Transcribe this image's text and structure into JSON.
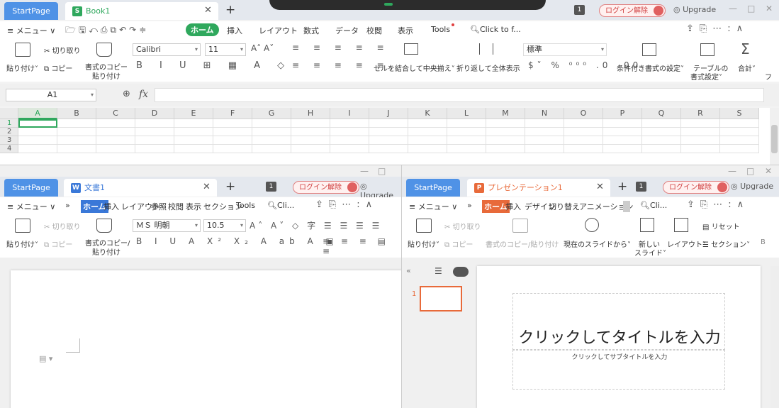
{
  "sheet": {
    "tabs": {
      "start": "StartPage",
      "doc": "Book1"
    },
    "login": "ログイン解除",
    "upgrade": "Upgrade",
    "num_badge": "1",
    "menu": [
      "≡ メニュー ∨",
      "ホーム",
      "挿入",
      "レイアウト",
      "数式",
      "データ",
      "校閲",
      "表示",
      "Tools",
      "Click to f..."
    ],
    "active_menu": "ホーム",
    "ribbon": {
      "paste": "貼り付け˅",
      "cut": "切り取り",
      "copy": "コピー",
      "format_copy": "書式のコピー",
      "format_copy2": "貼り付け",
      "font": "Calibri",
      "size": "11",
      "merge": "セルを結合して中央揃え˅",
      "wrap": "折り返して全体表示",
      "numfmt": "標準",
      "cond": "条件付き書式の設定˅",
      "table": "テーブルの",
      "table2": "書式設定˅",
      "sum": "合計˅",
      "f": "フ"
    },
    "namebox": "A1",
    "fx": "fx",
    "columns": [
      "A",
      "B",
      "C",
      "D",
      "E",
      "F",
      "G",
      "H",
      "I",
      "J",
      "K",
      "L",
      "M",
      "N",
      "O",
      "P",
      "Q",
      "R",
      "S"
    ],
    "rows": [
      "1",
      "2",
      "3",
      "4"
    ]
  },
  "writer": {
    "tabs": {
      "start": "StartPage",
      "doc": "文書1"
    },
    "login": "ログイン解除",
    "upgrade": "Upgrade",
    "num_badge": "1",
    "menu": [
      "≡ メニュー ∨",
      "»",
      "ホーム",
      "挿入",
      "レイアウト",
      "参照",
      "校閲",
      "表示",
      "セクション",
      "Tools",
      "Cli..."
    ],
    "active_menu": "ホーム",
    "ribbon": {
      "paste": "貼り付け˅",
      "cut": "切り取り",
      "copy": "コピー",
      "format_copy": "書式のコピー/",
      "format_copy2": "貼り付け",
      "font": "ＭＳ 明朝",
      "size": "10.5"
    }
  },
  "present": {
    "tabs": {
      "start": "StartPage",
      "doc": "プレゼンテーション1"
    },
    "login": "ログイン解除",
    "upgrade": "Upgrade",
    "num_badge": "1",
    "menu": [
      "≡ メニュー ∨",
      "»",
      "ホーム",
      "挿入",
      "デザイン",
      "切り替え",
      "アニメーション",
      "Cli..."
    ],
    "active_menu": "ホーム",
    "ribbon": {
      "paste": "貼り付け˅",
      "cut": "切り取り",
      "copy": "コピー",
      "format_copy": "書式のコピー/貼り付け",
      "from_current": "現在のスライドから˅",
      "new_slide": "新しい",
      "new_slide2": "スライド˅",
      "layout": "レイアウト˅",
      "section": "セクション˅",
      "reset": "リセット",
      "b": "B"
    },
    "slide_number": "1",
    "title_placeholder": "クリックしてタイトルを入力",
    "subtitle_placeholder": "クリックしてサブタイトルを入力"
  },
  "colors": {
    "sheet": "#2fa85d",
    "writer": "#3a78d8",
    "present": "#e86a3a",
    "tab_blue": "#4f92e6"
  }
}
